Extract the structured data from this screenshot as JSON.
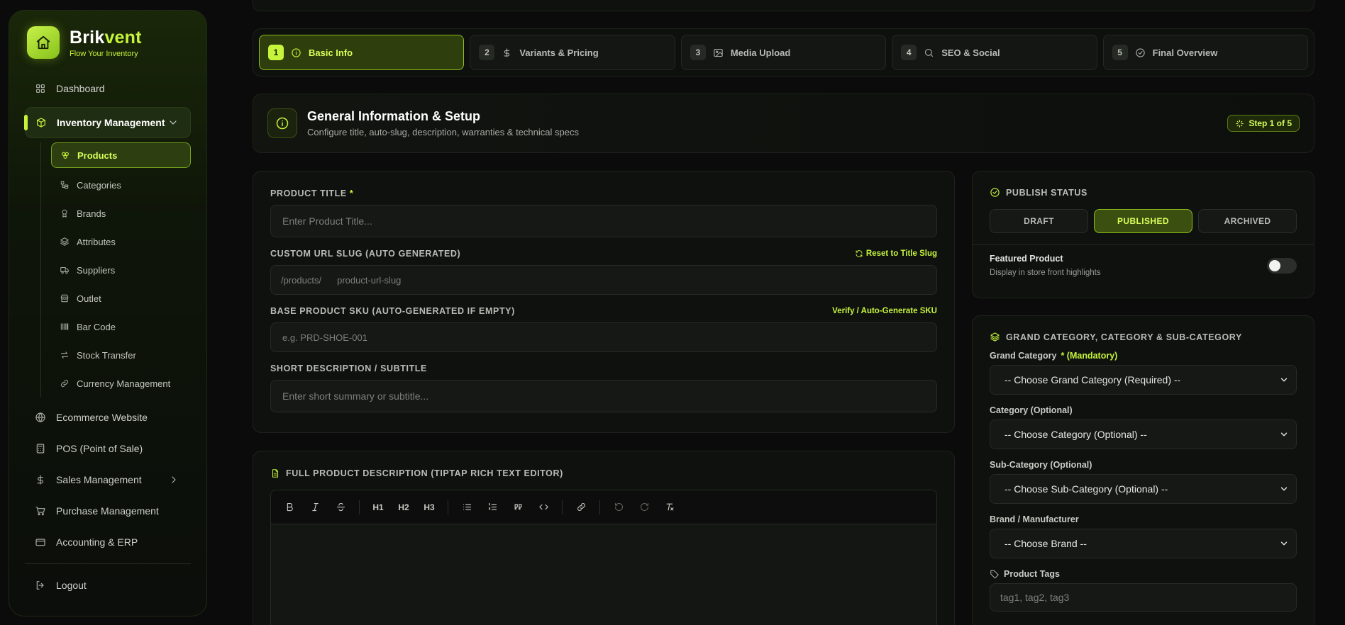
{
  "brand": {
    "name_part1": "Brik",
    "name_part2": "vent",
    "tagline": "Flow Your Inventory"
  },
  "sidebar": {
    "items": [
      {
        "label": "Dashboard",
        "icon": "grid-icon"
      },
      {
        "label": "Inventory Management",
        "icon": "box-icon",
        "expanded": true
      },
      {
        "label": "Ecommerce Website",
        "icon": "globe-icon"
      },
      {
        "label": "POS (Point of Sale)",
        "icon": "calculator-icon"
      },
      {
        "label": "Sales Management",
        "icon": "dollar-icon",
        "has_children": true
      },
      {
        "label": "Purchase Management",
        "icon": "cart-icon"
      },
      {
        "label": "Accounting & ERP",
        "icon": "card-icon"
      }
    ],
    "inventory_sub": [
      {
        "label": "Products",
        "icon": "products-icon",
        "active": true
      },
      {
        "label": "Categories",
        "icon": "categories-icon"
      },
      {
        "label": "Brands",
        "icon": "brand-icon"
      },
      {
        "label": "Attributes",
        "icon": "layers-icon"
      },
      {
        "label": "Suppliers",
        "icon": "truck-icon"
      },
      {
        "label": "Outlet",
        "icon": "store-icon"
      },
      {
        "label": "Bar Code",
        "icon": "barcode-icon"
      },
      {
        "label": "Stock Transfer",
        "icon": "transfer-icon"
      },
      {
        "label": "Currency Management",
        "icon": "link-icon"
      }
    ],
    "logout": "Logout"
  },
  "steps": [
    {
      "num": "1",
      "label": "Basic Info",
      "icon": "info-icon",
      "active": true
    },
    {
      "num": "2",
      "label": "Variants & Pricing",
      "icon": "dollar-icon"
    },
    {
      "num": "3",
      "label": "Media Upload",
      "icon": "image-icon"
    },
    {
      "num": "4",
      "label": "SEO & Social",
      "icon": "search-icon"
    },
    {
      "num": "5",
      "label": "Final Overview",
      "icon": "check-circle-icon"
    }
  ],
  "header": {
    "title": "General Information & Setup",
    "subtitle": "Configure title, auto-slug, description, warranties & technical specs",
    "badge": "Step 1 of 5"
  },
  "form": {
    "title_label": "PRODUCT TITLE",
    "title_required": "*",
    "title_placeholder": "Enter Product Title...",
    "slug_label": "CUSTOM URL SLUG (AUTO GENERATED)",
    "slug_reset": "Reset to Title Slug",
    "slug_prefix": "/products/",
    "slug_placeholder": "product-url-slug",
    "sku_label": "BASE PRODUCT SKU (AUTO-GENERATED IF EMPTY)",
    "sku_action": "Verify / Auto-Generate SKU",
    "sku_placeholder": "e.g. PRD-SHOE-001",
    "short_desc_label": "SHORT DESCRIPTION / SUBTITLE",
    "short_desc_placeholder": "Enter short summary or subtitle..."
  },
  "editor": {
    "title": "FULL PRODUCT DESCRIPTION (TIPTAP RICH TEXT EDITOR)",
    "h1": "H1",
    "h2": "H2",
    "h3": "H3"
  },
  "publish": {
    "title": "PUBLISH STATUS",
    "options": [
      "DRAFT",
      "PUBLISHED",
      "ARCHIVED"
    ],
    "selected": "PUBLISHED",
    "featured_title": "Featured Product",
    "featured_sub": "Display in store front highlights",
    "featured_on": false
  },
  "categories": {
    "title": "GRAND CATEGORY, CATEGORY & SUB-CATEGORY",
    "grand_label": "Grand Category",
    "grand_mandatory": "* (Mandatory)",
    "grand_value": "-- Choose Grand Category (Required) --",
    "cat_label": "Category (Optional)",
    "cat_value": "-- Choose Category (Optional) --",
    "sub_label": "Sub-Category (Optional)",
    "sub_value": "-- Choose Sub-Category (Optional) --",
    "brand_label": "Brand / Manufacturer",
    "brand_value": "-- Choose Brand --",
    "tags_label": "Product Tags",
    "tags_placeholder": "tag1, tag2, tag3"
  },
  "colors": {
    "accent": "#c6f43a",
    "background": "#0a0b0a",
    "card": "#0f110f"
  }
}
